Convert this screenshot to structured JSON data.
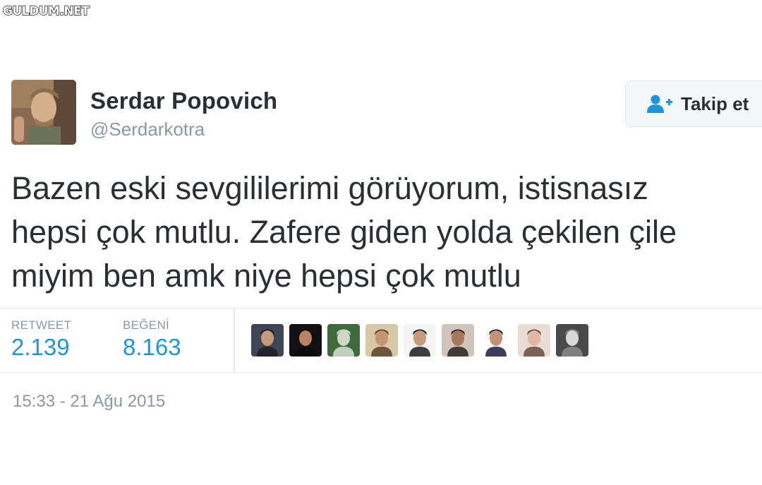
{
  "watermark": "GULDUM.NET",
  "tweet": {
    "author": {
      "name": "Serdar Popovich",
      "handle": "@Serdarkotra",
      "avatar_icon": "profile-photo"
    },
    "follow_button": {
      "label": "Takip et",
      "icon": "add-user-icon"
    },
    "text_lines": [
      "Bazen eski sevgililerimi görüyorum, istisnasız",
      "hepsi çok mutlu. Zafere giden yolda çekilen çile",
      "miyim ben amk niye hepsi çok mutlu"
    ],
    "stats": {
      "retweet_label": "RETWEET",
      "retweet_count": "2.139",
      "like_label": "BEĞENİ",
      "like_count": "8.163"
    },
    "likers": [
      {
        "icon": "liker-avatar",
        "bg": "#3d4656",
        "skin": "#c79a7a",
        "hair": "#1e1e22"
      },
      {
        "icon": "liker-avatar",
        "bg": "#111114",
        "skin": "#b98262",
        "hair": "#0c0c0c"
      },
      {
        "icon": "liker-avatar",
        "bg": "#3f6b3a",
        "skin": "#cfd7c8",
        "hair": "#d8e0d4"
      },
      {
        "icon": "liker-avatar",
        "bg": "#d8c9a6",
        "skin": "#c49570",
        "hair": "#5a4128"
      },
      {
        "icon": "liker-avatar",
        "bg": "#f4f4f4",
        "skin": "#c79a7a",
        "hair": "#1c1c1c"
      },
      {
        "icon": "liker-avatar",
        "bg": "#cfc5b9",
        "skin": "#a67658",
        "hair": "#2a2220"
      },
      {
        "icon": "liker-avatar",
        "bg": "#ffffff",
        "skin": "#c69179",
        "hair": "#1a1a40"
      },
      {
        "icon": "liker-avatar",
        "bg": "#e9dcd5",
        "skin": "#e1b79f",
        "hair": "#6a4a3a"
      },
      {
        "icon": "liker-avatar",
        "bg": "#4a4a4a",
        "skin": "#d9d9d9",
        "hair": "#8a8a8a"
      }
    ],
    "timestamp": "15:33 - 21 Ağu 2015"
  },
  "colors": {
    "name": "#292f33",
    "muted": "#8899a6",
    "accent": "#1b95e0",
    "border": "#e1e8ed"
  }
}
